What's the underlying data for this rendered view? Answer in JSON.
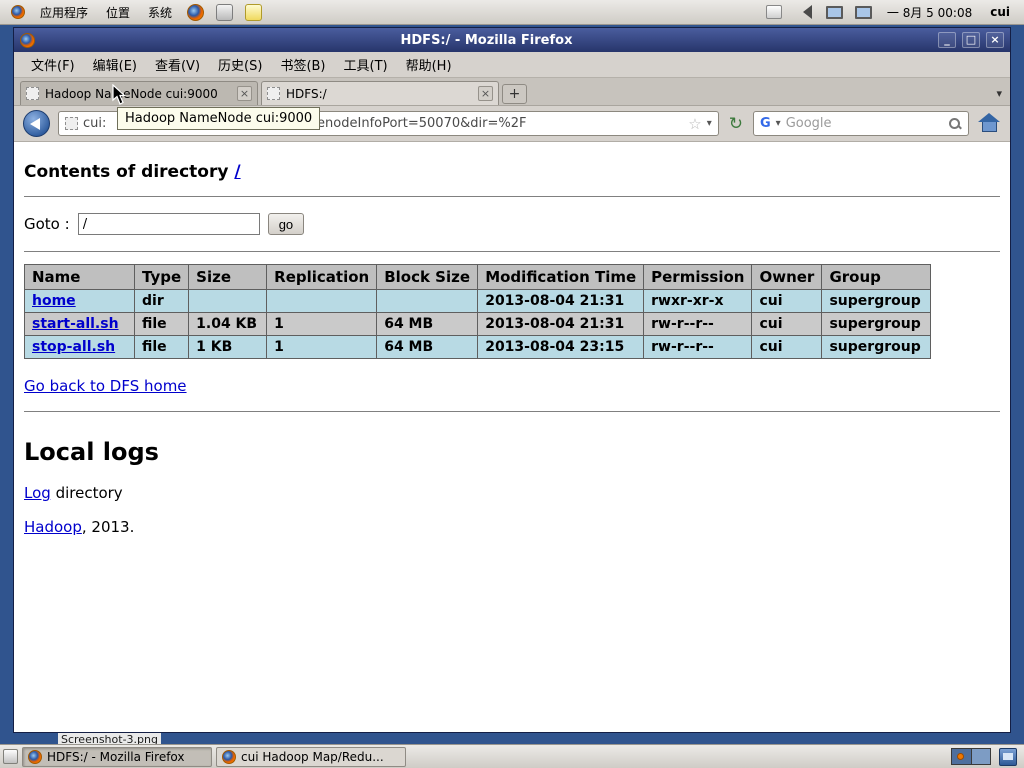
{
  "desktop": {
    "icon_label": "Screenshot-3.png"
  },
  "top_panel": {
    "menus": [
      "应用程序",
      "位置",
      "系统"
    ],
    "clock": "一 8月 5 00:08",
    "user": "cui"
  },
  "browser": {
    "title": "HDFS:/ - Mozilla Firefox",
    "window_controls": {
      "minimize": "_",
      "maximize": "□",
      "close": "×"
    },
    "menu_bar": [
      "文件(F)",
      "编辑(E)",
      "查看(V)",
      "历史(S)",
      "书签(B)",
      "工具(T)",
      "帮助(H)"
    ],
    "tabs": [
      {
        "label": "Hadoop NameNode cui:9000"
      },
      {
        "label": "HDFS:/"
      }
    ],
    "tab_close_glyph": "×",
    "new_tab_glyph": "+",
    "tab_list_glyph": "▾",
    "tooltip": "Hadoop NameNode cui:9000",
    "urlbar": {
      "visible_prefix": "cui:",
      "visible_suffix": "menodeInfoPort=50070&dir=%2F",
      "star_glyph": "☆",
      "dropdown_glyph": "▾",
      "reload_glyph": "↻"
    },
    "search": {
      "engine_letter": "G",
      "placeholder": "Google",
      "dropdown_glyph": "▾"
    }
  },
  "page": {
    "heading_text": "Contents of directory ",
    "heading_link": "/",
    "goto_label": "Goto :",
    "goto_value": "/",
    "go_button": "go",
    "table": {
      "headers": [
        "Name",
        "Type",
        "Size",
        "Replication",
        "Block Size",
        "Modification Time",
        "Permission",
        "Owner",
        "Group"
      ],
      "rows": [
        {
          "name": "home",
          "type": "dir",
          "size": "",
          "replication": "",
          "block_size": "",
          "mtime": "2013-08-04 21:31",
          "permission": "rwxr-xr-x",
          "owner": "cui",
          "group": "supergroup"
        },
        {
          "name": "start-all.sh",
          "type": "file",
          "size": "1.04 KB",
          "replication": "1",
          "block_size": "64 MB",
          "mtime": "2013-08-04 21:31",
          "permission": "rw-r--r--",
          "owner": "cui",
          "group": "supergroup"
        },
        {
          "name": "stop-all.sh",
          "type": "file",
          "size": "1 KB",
          "replication": "1",
          "block_size": "64 MB",
          "mtime": "2013-08-04 23:15",
          "permission": "rw-r--r--",
          "owner": "cui",
          "group": "supergroup"
        }
      ]
    },
    "dfs_home_link": "Go back to DFS home",
    "local_logs_heading": "Local logs",
    "log_link": "Log",
    "log_suffix": " directory",
    "footer_link": "Hadoop",
    "footer_suffix": ", 2013."
  },
  "taskbar": {
    "windows": [
      {
        "label": "HDFS:/ - Mozilla Firefox"
      },
      {
        "label": "cui Hadoop Map/Redu..."
      }
    ]
  },
  "colors": {
    "link": "#0000cc",
    "titlebar": "#27356b",
    "table_header_bg": "#bfbfbf",
    "table_row_blue": "#b8dae4",
    "table_row_gray": "#cacaca",
    "desktop": "#30548e"
  }
}
